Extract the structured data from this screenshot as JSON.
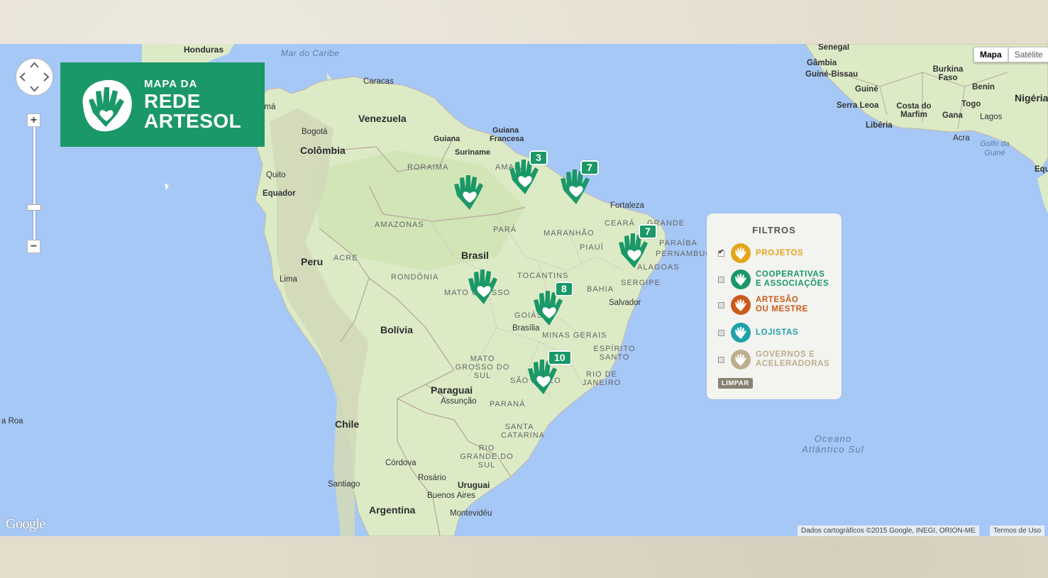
{
  "logo": {
    "line1": "MAPA DA",
    "line2": "REDE",
    "line3": "ARTESOL",
    "color": "#1b9867"
  },
  "map_type": {
    "map_label": "Mapa",
    "satellite_label": "Satélite",
    "selected": "Mapa"
  },
  "zoom": {
    "in_label": "+",
    "out_label": "−"
  },
  "labels": {
    "countries": [
      "Venezuela",
      "Colômbia",
      "Brasil",
      "Peru",
      "Bolívia",
      "Paraguai",
      "Chile",
      "Argentina",
      "Uruguai",
      "Equador",
      "Guiana",
      "Suriname",
      "Guiana Francesa",
      "Honduras",
      "Senegal",
      "Gâmbia",
      "Guiné-Bissau",
      "Guiné",
      "Serra Leoa",
      "Libéria",
      "Costa do Marfim",
      "Gana",
      "Togo",
      "Benin",
      "Burkina Faso",
      "Nigéria"
    ],
    "states": [
      "RORAIMA",
      "AMAPÁ",
      "AMAZONAS",
      "PARÁ",
      "MARANHÃO",
      "CEARÁ",
      "RIO GRANDE DO NORTE",
      "PARAÍBA",
      "PERNAMBUCO",
      "ALAGOAS",
      "SERGIPE",
      "PIAUÍ",
      "ACRE",
      "RONDÔNIA",
      "TOCANTINS",
      "BAHIA",
      "MATO GROSSO",
      "GOIÁS",
      "MINAS GERAIS",
      "ESPÍRITO SANTO",
      "MATO GROSSO DO SUL",
      "RIO DE JANEIRO",
      "SÃO PAULO",
      "PARANÁ",
      "SANTA CATARINA",
      "RIO GRANDE DO SUL"
    ],
    "cities": [
      "Caracas",
      "Bogotá",
      "Quito",
      "Lima",
      "Fortaleza",
      "Salvador",
      "Brasília",
      "Assunção",
      "Córdova",
      "Santiago",
      "Rosário",
      "Buenos Aires",
      "Montevidéu",
      "Lagos",
      "Acra"
    ],
    "water": [
      "Mar do Caribe",
      "Oceano",
      "Atlântico Sul",
      "Golfo da",
      "Guiné"
    ],
    "cut": [
      "amá",
      "a Roa",
      "Equ"
    ]
  },
  "markers": [
    {
      "id": "roraima",
      "count": ""
    },
    {
      "id": "amapa",
      "count": "3"
    },
    {
      "id": "para-coast",
      "count": "7"
    },
    {
      "id": "nordeste",
      "count": "7"
    },
    {
      "id": "mato-grosso",
      "count": ""
    },
    {
      "id": "goias",
      "count": "8"
    },
    {
      "id": "sao-paulo",
      "count": "10"
    }
  ],
  "filters": {
    "title": "FILTROS",
    "items": [
      {
        "line1": "PROJETOS",
        "line2": "",
        "color": "#e3a51b",
        "checked": true
      },
      {
        "line1": "COOPERATIVAS",
        "line2": "E ASSOCIAÇÕES",
        "color": "#1b9867",
        "checked": false
      },
      {
        "line1": "ARTESÃO",
        "line2": "OU MESTRE",
        "color": "#c95a1a",
        "checked": false
      },
      {
        "line1": "LOJISTAS",
        "line2": "",
        "color": "#1fa2a8",
        "checked": false
      },
      {
        "line1": "GOVERNOS E",
        "line2": "ACELERADORAS",
        "color": "#bdae8d",
        "checked": false
      }
    ],
    "clear_label": "LIMPAR"
  },
  "footer": {
    "google": "Google",
    "attribution": "Dados cartográficos ©2015 Google, INEGI, ORION-ME",
    "terms": "Termos de Uso"
  }
}
